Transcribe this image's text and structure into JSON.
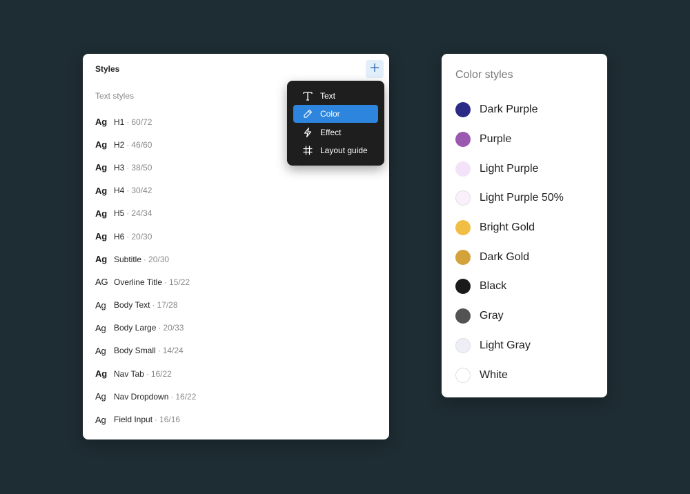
{
  "styles_panel": {
    "title": "Styles",
    "add_icon": "plus-icon",
    "section_label": "Text styles",
    "text_styles": [
      {
        "sample": "Ag",
        "weight": "bold",
        "name": "H1",
        "metric": "60/72"
      },
      {
        "sample": "Ag",
        "weight": "bold",
        "name": "H2",
        "metric": "46/60"
      },
      {
        "sample": "Ag",
        "weight": "bold",
        "name": "H3",
        "metric": "38/50"
      },
      {
        "sample": "Ag",
        "weight": "bold",
        "name": "H4",
        "metric": "30/42"
      },
      {
        "sample": "Ag",
        "weight": "bold",
        "name": "H5",
        "metric": "24/34"
      },
      {
        "sample": "Ag",
        "weight": "bold",
        "name": "H6",
        "metric": "20/30"
      },
      {
        "sample": "Ag",
        "weight": "bold",
        "name": "Subtitle",
        "metric": "20/30"
      },
      {
        "sample": "AG",
        "weight": "normal",
        "name": "Overline Title",
        "metric": "15/22"
      },
      {
        "sample": "Ag",
        "weight": "normal",
        "name": "Body Text",
        "metric": "17/28"
      },
      {
        "sample": "Ag",
        "weight": "normal",
        "name": "Body Large",
        "metric": "20/33"
      },
      {
        "sample": "Ag",
        "weight": "normal",
        "name": "Body Small",
        "metric": "14/24"
      },
      {
        "sample": "Ag",
        "weight": "bold",
        "name": "Nav Tab",
        "metric": "16/22"
      },
      {
        "sample": "Ag",
        "weight": "normal",
        "name": "Nav Dropdown",
        "metric": "16/22"
      },
      {
        "sample": "Ag",
        "weight": "normal",
        "name": "Field Input",
        "metric": "16/16"
      }
    ]
  },
  "create_menu": {
    "items": [
      {
        "label": "Text",
        "icon": "text-icon",
        "active": false
      },
      {
        "label": "Color",
        "icon": "eyedropper-icon",
        "active": true
      },
      {
        "label": "Effect",
        "icon": "lightning-icon",
        "active": false
      },
      {
        "label": "Layout guide",
        "icon": "grid-icon",
        "active": false
      }
    ]
  },
  "color_panel": {
    "title": "Color styles",
    "colors": [
      {
        "name": "Dark Purple",
        "hex": "#2b2a86",
        "outlined": false
      },
      {
        "name": "Purple",
        "hex": "#9a58b0",
        "outlined": false
      },
      {
        "name": "Light Purple",
        "hex": "#f3e2f8",
        "outlined": false
      },
      {
        "name": "Light Purple 50%",
        "hex": "#f9f0fb",
        "outlined": true
      },
      {
        "name": "Bright Gold",
        "hex": "#f0be45",
        "outlined": false
      },
      {
        "name": "Dark Gold",
        "hex": "#d4a23a",
        "outlined": false
      },
      {
        "name": "Black",
        "hex": "#1a1a1a",
        "outlined": false
      },
      {
        "name": "Gray",
        "hex": "#535353",
        "outlined": false
      },
      {
        "name": "Light Gray",
        "hex": "#eeeef6",
        "outlined": true
      },
      {
        "name": "White",
        "hex": "#ffffff",
        "outlined": true
      }
    ]
  },
  "colors": {
    "background": "#1e2d33",
    "menu_background": "#1e1e1e",
    "menu_active": "#2d85dd",
    "add_button_bg": "#e3eefb",
    "accent": "#2d85dd"
  }
}
